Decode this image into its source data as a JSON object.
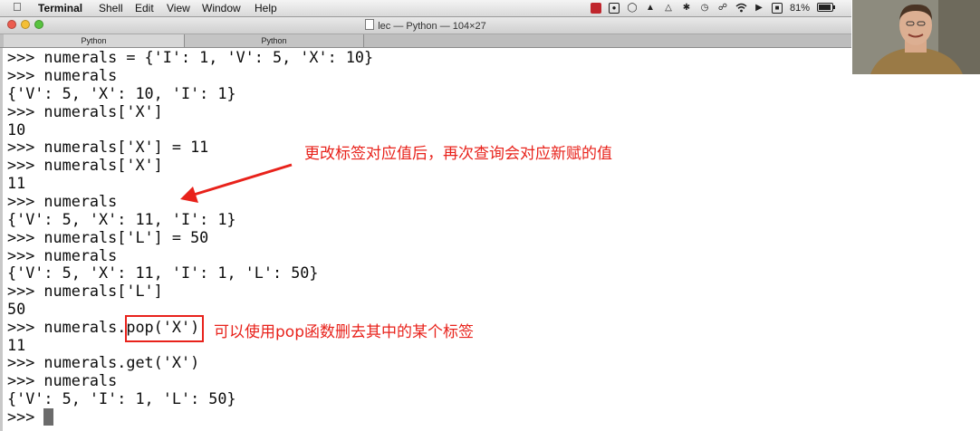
{
  "menubar": {
    "app_name": "Terminal",
    "items": [
      "Shell",
      "Edit",
      "View",
      "Window",
      "Help"
    ],
    "battery": "81%",
    "icons": [
      "apple-icon",
      "record-icon",
      "wifi-icon",
      "volume-icon",
      "battery-icon"
    ]
  },
  "window": {
    "title": "lec — Python — 104×27",
    "traffic_light_colors": [
      "#ec5c4f",
      "#f4bf36",
      "#58c33f"
    ],
    "tabs": [
      {
        "label": "Python"
      },
      {
        "label": "Python"
      }
    ]
  },
  "terminal": {
    "lines": [
      ">>> numerals = {'I': 1, 'V': 5, 'X': 10}",
      ">>> numerals",
      "{'V': 5, 'X': 10, 'I': 1}",
      ">>> numerals['X']",
      "10",
      ">>> numerals['X'] = 11",
      ">>> numerals['X']",
      "11",
      ">>> numerals",
      "{'V': 5, 'X': 11, 'I': 1}",
      ">>> numerals['L'] = 50",
      ">>> numerals",
      "{'V': 5, 'X': 11, 'I': 1, 'L': 50}",
      ">>> numerals['L']",
      "50",
      ">>> numerals.pop('X')",
      "11",
      ">>> numerals.get('X')",
      ">>> numerals",
      "{'V': 5, 'I': 1, 'L': 50}",
      ">>> "
    ]
  },
  "annotations": {
    "note1": "更改标签对应值后，再次查询会对应新赋的值",
    "note2": "可以使用pop函数删去其中的某个标签",
    "color": "#e8221b"
  }
}
